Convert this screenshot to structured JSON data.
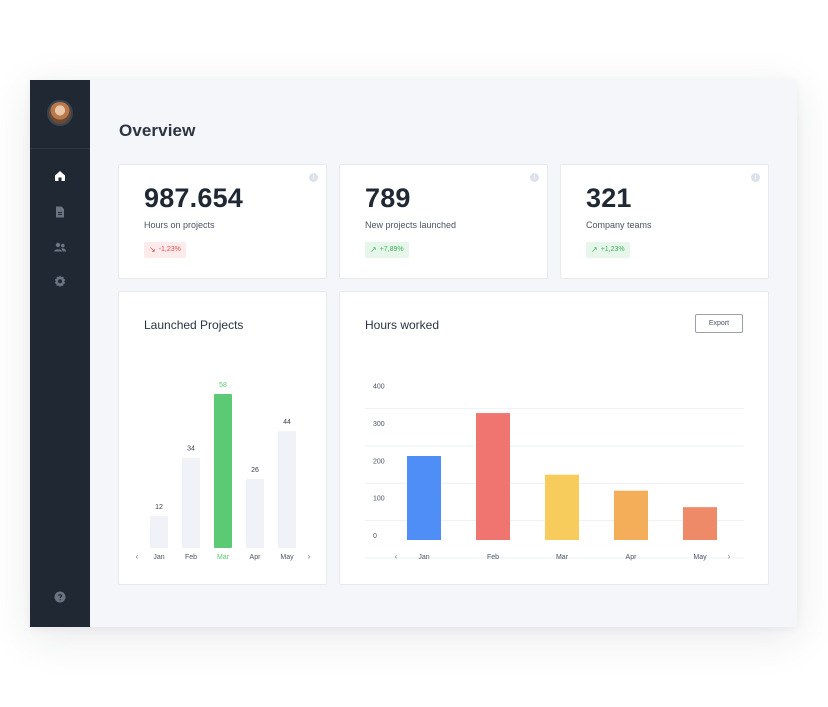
{
  "page": {
    "title": "Overview"
  },
  "sidebar": {
    "items": [
      {
        "name": "home",
        "icon": "home-icon",
        "active": true
      },
      {
        "name": "documents",
        "icon": "document-icon",
        "active": false
      },
      {
        "name": "users",
        "icon": "users-icon",
        "active": false
      },
      {
        "name": "settings",
        "icon": "gear-icon",
        "active": false
      }
    ],
    "help_icon": "help-icon"
  },
  "stats": [
    {
      "value": "987.654",
      "label": "Hours on projects",
      "change": "-1,23%",
      "direction": "down"
    },
    {
      "value": "789",
      "label": "New projects launched",
      "change": "+7,89%",
      "direction": "up"
    },
    {
      "value": "321",
      "label": "Company teams",
      "change": "+1,23%",
      "direction": "up"
    }
  ],
  "launched": {
    "title": "Launched Projects"
  },
  "hours": {
    "title": "Hours worked",
    "export_label": "Export"
  },
  "colors": {
    "sidebar_bg": "#1f2833",
    "green": "#5cc974",
    "bar_idle": "#f1f2f7",
    "blue": "#4f8ef7",
    "red": "#f07470",
    "yellow": "#f7cc5c",
    "orange": "#f4ae5a",
    "salmon": "#ef8a68"
  },
  "chart_data": [
    {
      "type": "bar",
      "categories": [
        "Jan",
        "Feb",
        "Mar",
        "Apr",
        "May"
      ],
      "values": [
        12,
        34,
        58,
        26,
        44
      ],
      "data_labels": [
        "12",
        "34",
        "58",
        "26",
        "44"
      ],
      "highlighted": "Mar",
      "ylim": [
        0,
        58
      ],
      "nav": {
        "prev": "‹",
        "next": "›"
      }
    },
    {
      "type": "bar",
      "categories": [
        "Jan",
        "Feb",
        "Mar",
        "Apr",
        "May"
      ],
      "values": [
        225,
        340,
        175,
        132,
        88
      ],
      "ylim": [
        0,
        450
      ],
      "y_ticks": [
        0,
        100,
        200,
        300,
        400
      ],
      "grid": true,
      "bar_colors": [
        "#4f8ef7",
        "#f07470",
        "#f7cc5c",
        "#f4ae5a",
        "#ef8a68"
      ],
      "nav": {
        "prev": "‹",
        "next": "›"
      }
    }
  ]
}
